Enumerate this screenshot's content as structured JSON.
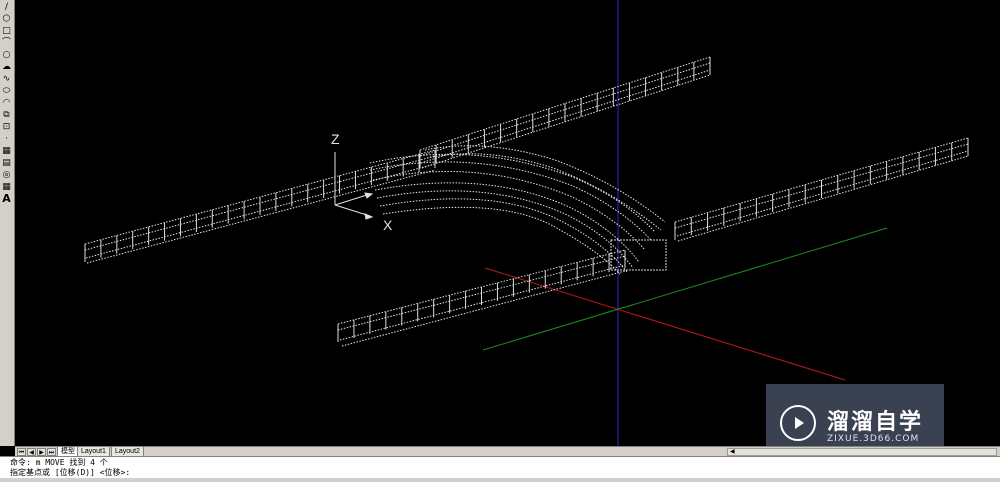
{
  "toolbar": {
    "tools": [
      {
        "name": "line-tool",
        "glyph": "/"
      },
      {
        "name": "polygon-tool",
        "glyph": "⬡"
      },
      {
        "name": "rectangle-tool",
        "glyph": "□"
      },
      {
        "name": "arc-tool",
        "glyph": "⌒"
      },
      {
        "name": "circle-tool",
        "glyph": "○"
      },
      {
        "name": "revcloud-tool",
        "glyph": "☁"
      },
      {
        "name": "spline-tool",
        "glyph": "∿"
      },
      {
        "name": "ellipse-tool",
        "glyph": "⬭"
      },
      {
        "name": "ellipse-arc-tool",
        "glyph": "◠"
      },
      {
        "name": "insert-block-tool",
        "glyph": "⧉"
      },
      {
        "name": "make-block-tool",
        "glyph": "⊡"
      },
      {
        "name": "point-tool",
        "glyph": "·"
      },
      {
        "name": "hatch-tool",
        "glyph": "▦"
      },
      {
        "name": "gradient-tool",
        "glyph": "▤"
      },
      {
        "name": "region-tool",
        "glyph": "◎"
      },
      {
        "name": "table-tool",
        "glyph": "▦"
      },
      {
        "name": "mtext-tool",
        "glyph": "A"
      }
    ]
  },
  "ucs": {
    "z_label": "Z",
    "x_label": "X"
  },
  "tabs": {
    "nav": [
      "⏮",
      "◀",
      "▶",
      "⏭"
    ],
    "items": [
      {
        "label": "模型",
        "active": true
      },
      {
        "label": "Layout1",
        "active": false
      },
      {
        "label": "Layout2",
        "active": false
      }
    ]
  },
  "command": {
    "line1": "命令: m MOVE 找到 4 个",
    "line2": "指定基点或 [位移(D)] <位移>:"
  },
  "watermark": {
    "title": "溜溜自学",
    "url": "ZIXUE.3D66.COM"
  },
  "colors": {
    "background": "#000000",
    "wire": "#ffffff",
    "axis_red": "#c0181e",
    "axis_green": "#1f8a1f",
    "axis_blue": "#1a1a8a",
    "watermark_bg": "#3a4151"
  }
}
